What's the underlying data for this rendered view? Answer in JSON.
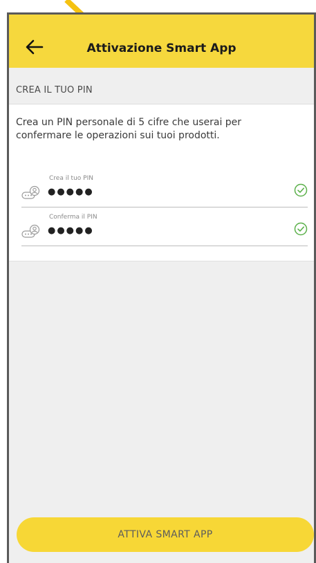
{
  "app_bar": {
    "title": "Attivazione Smart App",
    "back_icon": "arrow-left-icon",
    "background": "#f6d83d"
  },
  "section": {
    "header": "CREA IL TUO PIN",
    "description": "Crea un PIN personale di 5 cifre che userai per confermare le operazioni sui tuoi prodotti."
  },
  "form": {
    "pin_field": {
      "label": "Crea il tuo PIN",
      "value": "●●●●●",
      "icon": "person-pin-icon",
      "status_icon": "check-circle-icon"
    },
    "confirm_field": {
      "label": "Conferma il PIN",
      "value": "●●●●●",
      "icon": "person-pin-icon",
      "status_icon": "check-circle-icon"
    }
  },
  "actions": {
    "activate_label": "ATTIVA SMART APP"
  },
  "colors": {
    "accent": "#f6d83d",
    "check": "#5bb04a",
    "background": "#efefef"
  }
}
